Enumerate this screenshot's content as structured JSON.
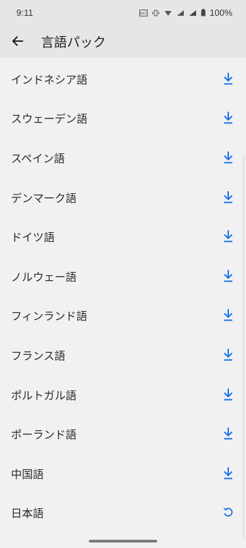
{
  "status_bar": {
    "time": "9:11",
    "battery": "100%",
    "icons": [
      "nfc-icon",
      "vibrate-icon",
      "data-saver-icon",
      "signal-4g-icon",
      "signal-icon",
      "battery-icon"
    ]
  },
  "app_bar": {
    "title": "言語パック",
    "back_icon": "back-arrow-icon"
  },
  "languages": [
    {
      "label": "インドネシア語",
      "action": "download"
    },
    {
      "label": "スウェーデン語",
      "action": "download"
    },
    {
      "label": "スペイン語",
      "action": "download"
    },
    {
      "label": "デンマーク語",
      "action": "download"
    },
    {
      "label": "ドイツ語",
      "action": "download"
    },
    {
      "label": "ノルウェー語",
      "action": "download"
    },
    {
      "label": "フィンランド語",
      "action": "download"
    },
    {
      "label": "フランス語",
      "action": "download"
    },
    {
      "label": "ポルトガル語",
      "action": "download"
    },
    {
      "label": "ポーランド語",
      "action": "download"
    },
    {
      "label": "中国語",
      "action": "download"
    },
    {
      "label": "日本語",
      "action": "refresh"
    }
  ],
  "colors": {
    "accent": "#1a73e8",
    "background": "#f1f1f1",
    "app_bar": "#e6e6e6"
  }
}
